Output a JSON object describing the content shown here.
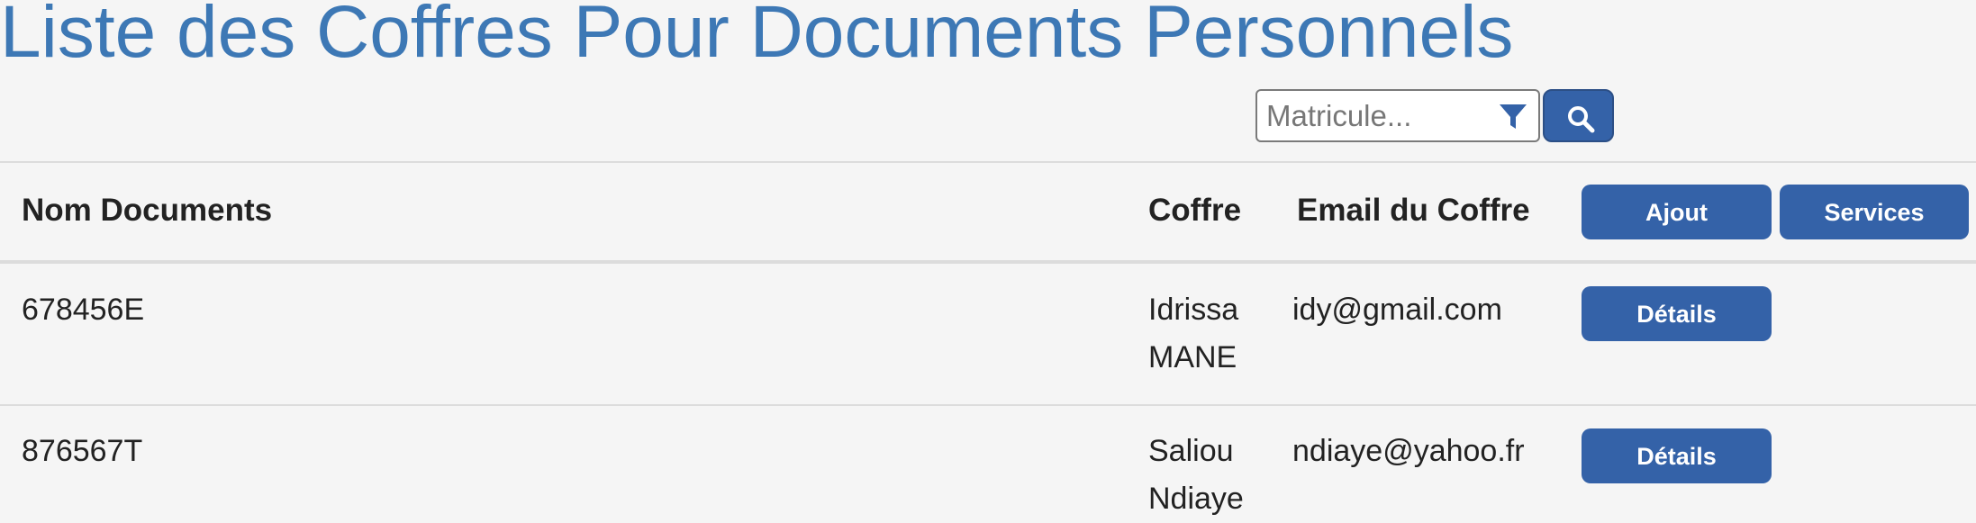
{
  "page": {
    "title": "Liste des Coffres Pour Documents Personnels"
  },
  "filter": {
    "placeholder": "Matricule...",
    "value": "",
    "filter_icon": "funnel-icon",
    "search_icon": "magnifier-icon"
  },
  "table": {
    "headers": {
      "nom_documents": "Nom Documents",
      "coffre": "Coffre",
      "email": "Email du Coffre"
    },
    "actions": {
      "ajout": "Ajout",
      "services": "Services"
    },
    "rows": [
      {
        "nom": "678456E",
        "coffre_line1": "Idrissa",
        "coffre_line2": "MANE",
        "email": "idy@gmail.com",
        "details": "Détails"
      },
      {
        "nom": "876567T",
        "coffre_line1": "Saliou",
        "coffre_line2": "Ndiaye",
        "email": "ndiaye@yahoo.fr",
        "details": "Détails"
      }
    ]
  },
  "colors": {
    "title": "#3d78b5",
    "button": "#3462a8",
    "background": "#f5f5f5"
  }
}
